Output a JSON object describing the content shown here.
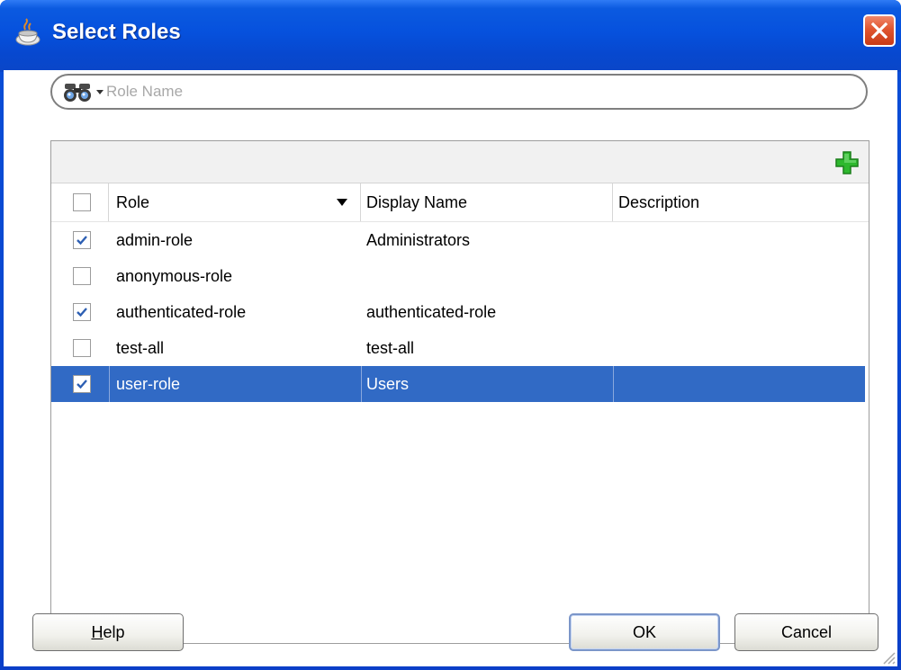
{
  "window": {
    "title": "Select Roles",
    "icon": "java-cup-icon",
    "close_icon": "close-icon"
  },
  "search": {
    "value": "",
    "placeholder": "Role Name",
    "icon": "binoculars-icon"
  },
  "toolbar": {
    "add_icon": "plus-icon",
    "add_color": "#2eb82e"
  },
  "table": {
    "select_all_checked": false,
    "columns": [
      {
        "label": "Role",
        "sorted": "descending"
      },
      {
        "label": "Display Name"
      },
      {
        "label": "Description"
      }
    ],
    "rows": [
      {
        "checked": true,
        "role": "admin-role",
        "display_name": "Administrators",
        "description": "",
        "selected": false
      },
      {
        "checked": false,
        "role": "anonymous-role",
        "display_name": "",
        "description": "",
        "selected": false
      },
      {
        "checked": true,
        "role": "authenticated-role",
        "display_name": "authenticated-role",
        "description": "",
        "selected": false
      },
      {
        "checked": false,
        "role": "test-all",
        "display_name": "test-all",
        "description": "",
        "selected": false
      },
      {
        "checked": true,
        "role": "user-role",
        "display_name": "Users",
        "description": "",
        "selected": true
      }
    ],
    "selection_color": "#316ac5"
  },
  "buttons": {
    "help": "Help",
    "ok": "OK",
    "cancel": "Cancel"
  },
  "colors": {
    "titlebar": "#0651dd",
    "close": "#e0552f",
    "check": "#2d5fb3"
  }
}
